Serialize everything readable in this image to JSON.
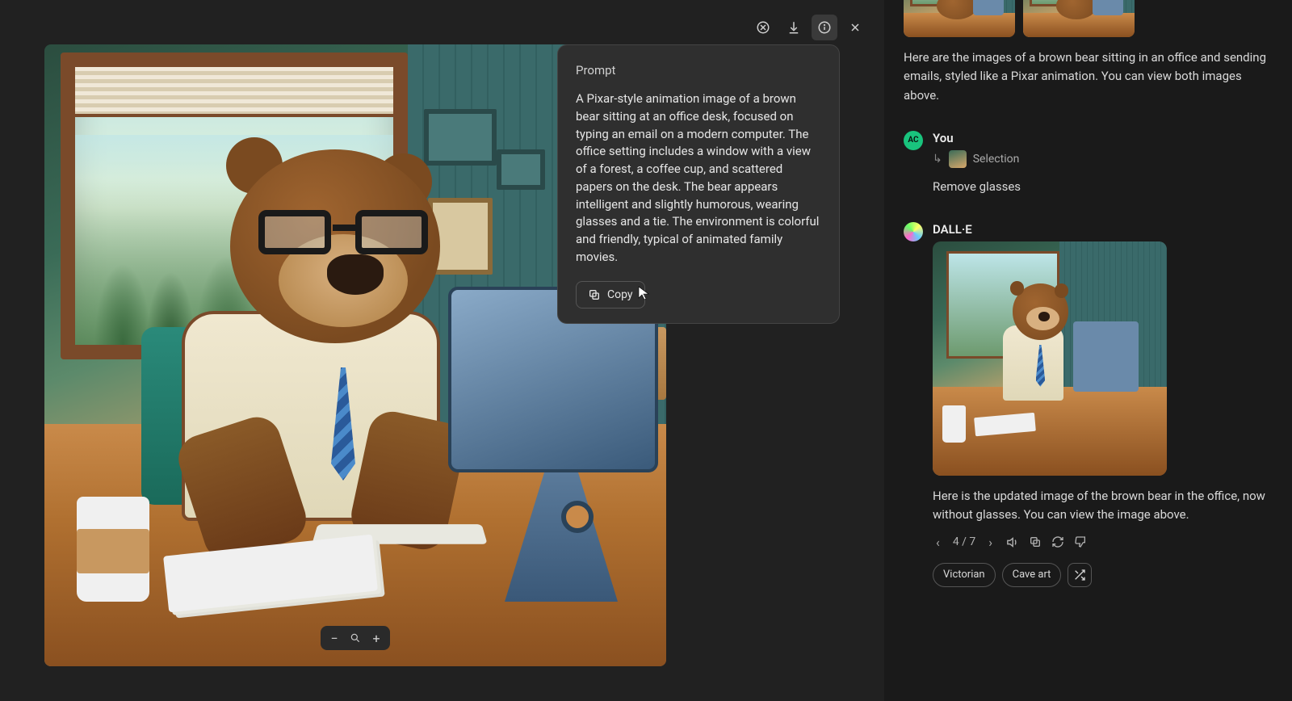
{
  "toolbar": {
    "select_tool": "select-tool",
    "download": "download",
    "info": "info",
    "close": "close"
  },
  "prompt_popover": {
    "title": "Prompt",
    "body": "A Pixar-style animation image of a brown bear sitting at an office desk, focused on typing an email on a modern computer. The office setting includes a window with a view of a forest, a coffee cup, and scattered papers on the desk. The bear appears intelligent and slightly humorous, wearing glasses and a tie. The environment is colorful and friendly, typical of animated family movies.",
    "copy_label": "Copy"
  },
  "zoom": {
    "out": "−",
    "reset": "⤢",
    "in": "+"
  },
  "chat": {
    "assistant_intro": "Here are the images of a brown bear sitting in an office and sending emails, styled like a Pixar animation. You can view both images above.",
    "user_name": "You",
    "user_avatar_initials": "AC",
    "user_selection_label": "Selection",
    "user_message": "Remove glasses",
    "dalle_name": "DALL·E",
    "dalle_caption": "Here is the updated image of the brown bear in the office, now without glasses. You can view the image above.",
    "pager": {
      "prev": "‹",
      "label": "4 / 7",
      "next": "›"
    },
    "actions": {
      "read_aloud": "read-aloud",
      "copy": "copy",
      "regenerate": "regenerate",
      "bad": "thumbs-down"
    },
    "styles": {
      "a": "Victorian",
      "b": "Cave art",
      "shuffle": "shuffle"
    }
  }
}
